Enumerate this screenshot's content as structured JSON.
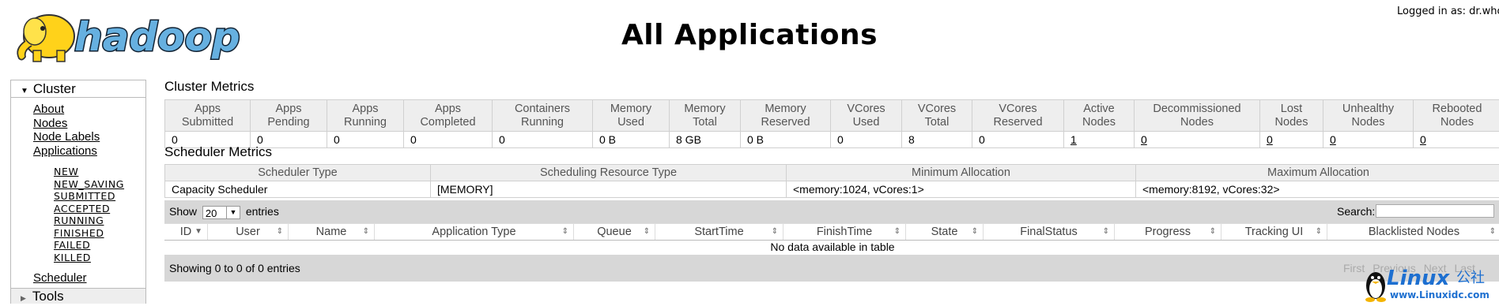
{
  "header": {
    "logo_text": "hadoop",
    "title": "All Applications",
    "logged_in": "Logged in as: dr.who"
  },
  "nav": {
    "cluster_label": "Cluster",
    "links": [
      "About",
      "Nodes",
      "Node Labels",
      "Applications"
    ],
    "states": [
      "NEW",
      "NEW_SAVING",
      "SUBMITTED",
      "ACCEPTED",
      "RUNNING",
      "FINISHED",
      "FAILED",
      "KILLED"
    ],
    "scheduler": "Scheduler",
    "tools_label": "Tools"
  },
  "cluster_metrics": {
    "title": "Cluster Metrics",
    "headers": [
      [
        "Apps",
        "Submitted"
      ],
      [
        "Apps",
        "Pending"
      ],
      [
        "Apps",
        "Running"
      ],
      [
        "Apps",
        "Completed"
      ],
      [
        "Containers",
        "Running"
      ],
      [
        "Memory",
        "Used"
      ],
      [
        "Memory",
        "Total"
      ],
      [
        "Memory",
        "Reserved"
      ],
      [
        "VCores",
        "Used"
      ],
      [
        "VCores",
        "Total"
      ],
      [
        "VCores",
        "Reserved"
      ],
      [
        "Active",
        "Nodes"
      ],
      [
        "Decommissioned",
        "Nodes"
      ],
      [
        "Lost",
        "Nodes"
      ],
      [
        "Unhealthy",
        "Nodes"
      ],
      [
        "Rebooted",
        "Nodes"
      ]
    ],
    "values": [
      "0",
      "0",
      "0",
      "0",
      "0",
      "0 B",
      "8 GB",
      "0 B",
      "0",
      "8",
      "0",
      "1",
      "0",
      "0",
      "0",
      "0"
    ]
  },
  "scheduler_metrics": {
    "title": "Scheduler Metrics",
    "headers": [
      "Scheduler Type",
      "Scheduling Resource Type",
      "Minimum Allocation",
      "Maximum Allocation"
    ],
    "values": [
      "Capacity Scheduler",
      "[MEMORY]",
      "<memory:1024, vCores:1>",
      "<memory:8192, vCores:32>"
    ]
  },
  "apps_table": {
    "show_label": "Show",
    "entries_value": "20",
    "entries_label": "entries",
    "search_label": "Search:",
    "search_value": "",
    "columns": [
      "ID",
      "User",
      "Name",
      "Application Type",
      "Queue",
      "StartTime",
      "FinishTime",
      "State",
      "FinalStatus",
      "Progress",
      "Tracking UI",
      "Blacklisted Nodes"
    ],
    "empty_text": "No data available in table",
    "showing": "Showing 0 to 0 of 0 entries",
    "pager": [
      "First",
      "Previous",
      "Next",
      "Last"
    ]
  },
  "watermark": {
    "brand": "Linux",
    "brand_cn": "公社",
    "url": "www.Linuxidc.com"
  },
  "colors": {
    "header_bg": "#eeeeee",
    "toolbar_bg": "#d7d7d7",
    "logo_yellow": "#ffd21a",
    "logo_blue": "#66b0e0",
    "wm_blue": "#1d6fd0"
  }
}
